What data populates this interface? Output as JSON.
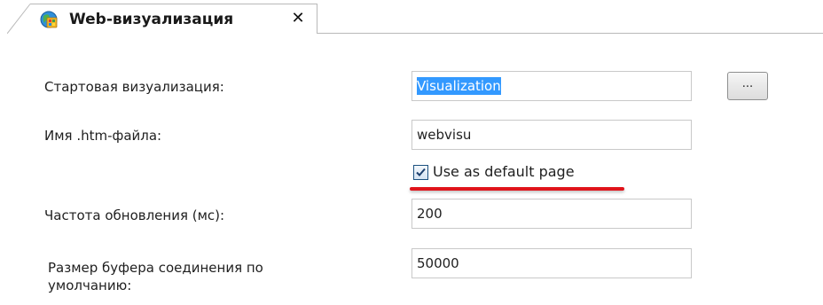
{
  "tab": {
    "title": "Web-визуализация",
    "close_glyph": "✕",
    "icon": "web-visualization-icon"
  },
  "form": {
    "start_visualization": {
      "label": "Стартовая визуализация:",
      "value": "Visualization",
      "browse_label": "..."
    },
    "htm_file_name": {
      "label": "Имя .htm-файла:",
      "value": "webvisu"
    },
    "default_page": {
      "label": "Use as default page",
      "checked": true
    },
    "refresh_rate": {
      "label": "Частота обновления (мс):",
      "value": "200"
    },
    "buffer_size": {
      "label": "Размер буфера соединения по умолчанию:",
      "value": "50000"
    }
  },
  "colors": {
    "highlight": "#e0141b",
    "selection": "#3399ff"
  }
}
